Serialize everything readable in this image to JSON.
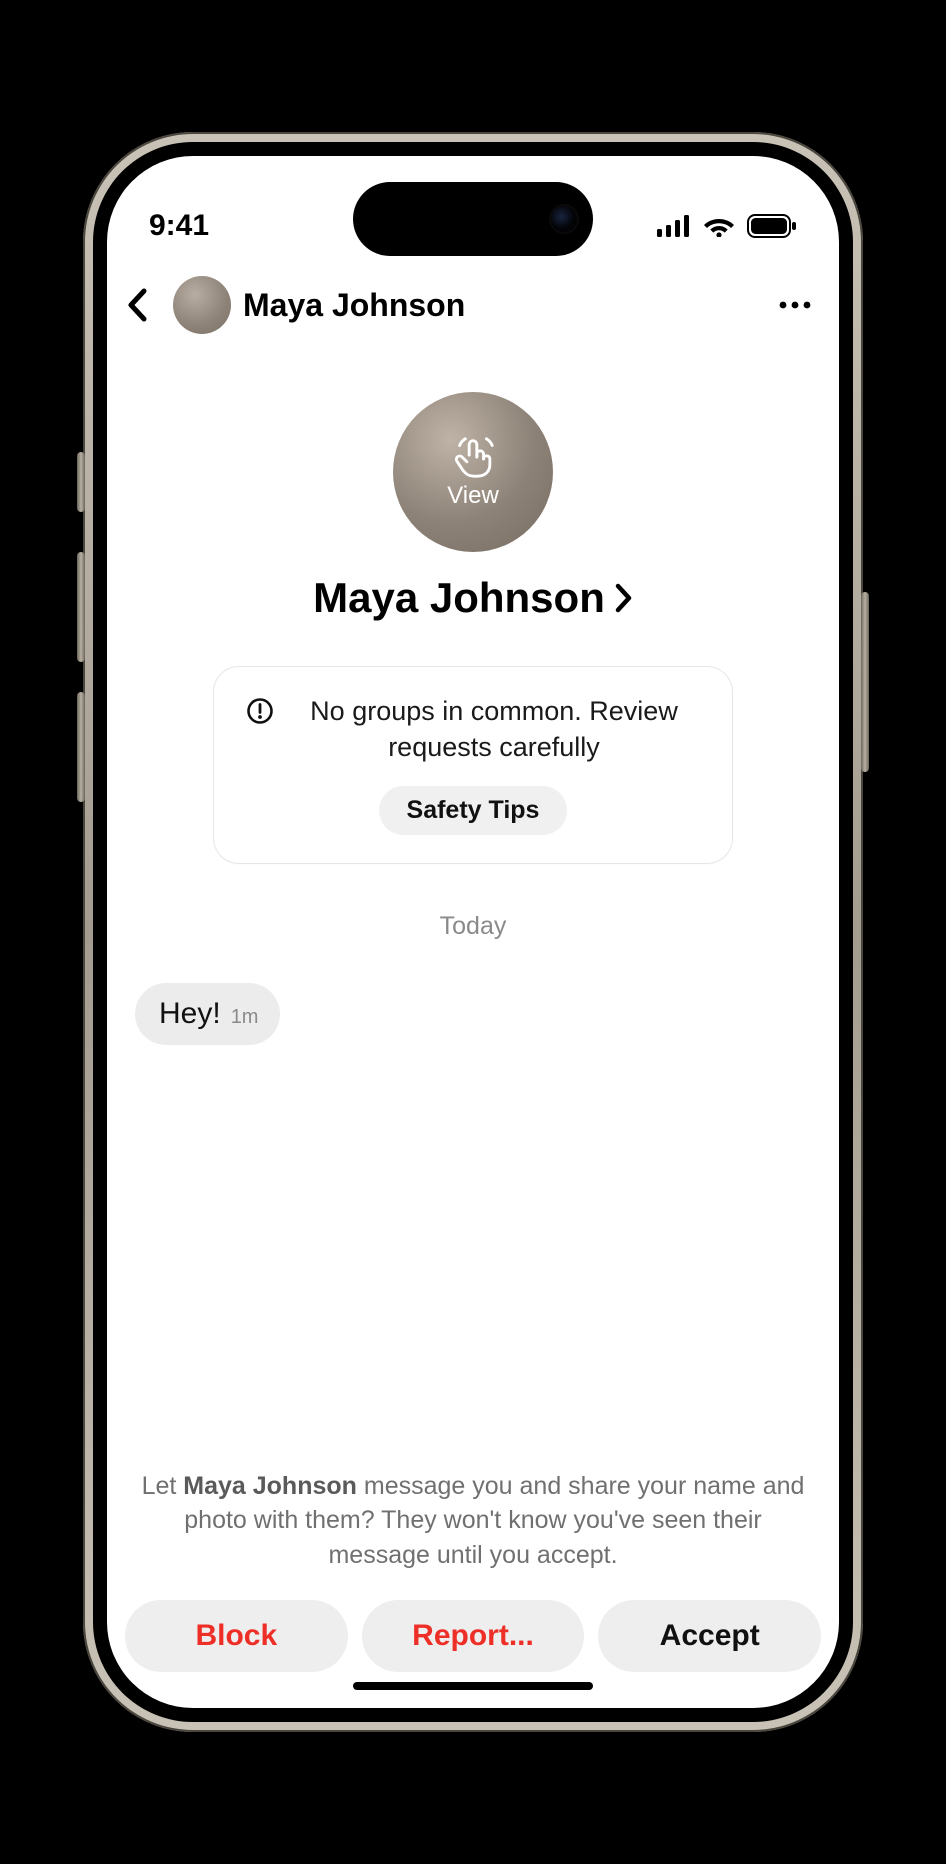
{
  "status": {
    "time": "9:41"
  },
  "nav": {
    "title": "Maya Johnson"
  },
  "profile": {
    "view_label": "View",
    "name": "Maya Johnson"
  },
  "safety_card": {
    "message": "No groups in common. Review requests carefully",
    "button": "Safety Tips"
  },
  "conversation": {
    "day_separator": "Today",
    "messages": [
      {
        "text": "Hey!",
        "timestamp": "1m"
      }
    ]
  },
  "request": {
    "prefix": "Let ",
    "name": "Maya Johnson",
    "suffix": " message you and share your name and photo with them? They won't know you've seen their message until you accept."
  },
  "actions": {
    "block": "Block",
    "report": "Report...",
    "accept": "Accept"
  }
}
